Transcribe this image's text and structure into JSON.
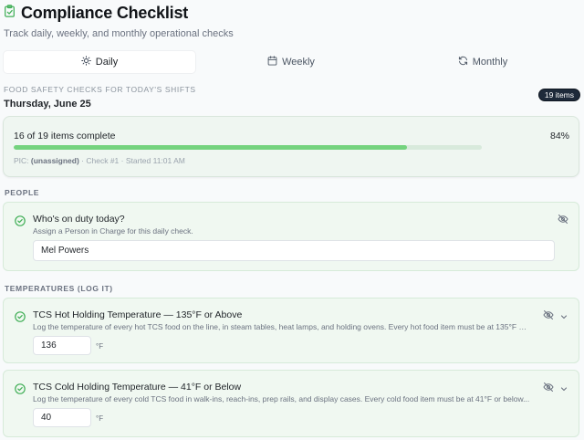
{
  "header": {
    "title": "Compliance Checklist",
    "subtitle": "Track daily, weekly, and monthly operational checks"
  },
  "tabs": [
    {
      "label": "Daily",
      "icon": "sun-icon",
      "active": true
    },
    {
      "label": "Weekly",
      "icon": "calendar-icon",
      "active": false
    },
    {
      "label": "Monthly",
      "icon": "refresh-icon",
      "active": false
    }
  ],
  "section": {
    "kicker": "FOOD SAFETY CHECKS FOR TODAY'S SHIFTS",
    "date": "Thursday, June 25",
    "badge": "19 items"
  },
  "progress": {
    "summary": "16 of 19 items complete",
    "percent_label": "84%",
    "fraction": 0.84,
    "pic_label": "PIC:",
    "pic_value": "(unassigned)",
    "meta_rest": " · Check #1 · Started 11:01 AM"
  },
  "groups": {
    "people": "PEOPLE",
    "temperatures": "TEMPERATURES (LOG IT)"
  },
  "items": {
    "duty": {
      "title": "Who's on duty today?",
      "desc": "Assign a Person in Charge for this daily check.",
      "value": "Mel Powers"
    },
    "hot": {
      "title": "TCS Hot Holding Temperature — 135°F or Above",
      "desc": "Log the temperature of every hot TCS food on the line, in steam tables, heat lamps, and holding ovens. Every hot food item must be at 135°F or...",
      "value": "136",
      "unit": "°F"
    },
    "cold": {
      "title": "TCS Cold Holding Temperature — 41°F or Below",
      "desc": "Log the temperature of every cold TCS food in walk-ins, reach-ins, prep rails, and display cases. Every cold food item must be at 41°F or below...",
      "value": "40",
      "unit": "°F"
    }
  },
  "colors": {
    "accent_green": "#74d37e",
    "check_green": "#3fae55",
    "badge_bg": "#1e2a3a"
  }
}
